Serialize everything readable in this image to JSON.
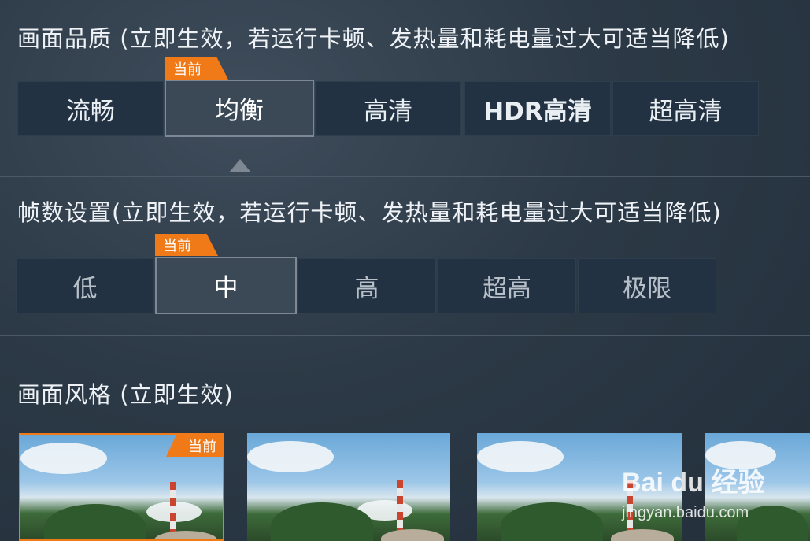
{
  "quality": {
    "title": "画面品质 (立即生效，若运行卡顿、发热量和耗电量过大可适当降低)",
    "current_badge": "当前",
    "options": [
      "流畅",
      "均衡",
      "高清",
      "HDR高清",
      "超高清"
    ],
    "selected": "均衡"
  },
  "framerate": {
    "title": "帧数设置(立即生效，若运行卡顿、发热量和耗电量过大可适当降低)",
    "current_badge": "当前",
    "options": [
      "低",
      "中",
      "高",
      "超高",
      "极限"
    ],
    "selected": "中"
  },
  "style": {
    "title": "画面风格 (立即生效)",
    "current_badge": "当前"
  },
  "watermark": {
    "brand": "Bai du 经验",
    "url": "jingyan.baidu.com"
  },
  "colors": {
    "accent": "#f07a18",
    "button_bg": "#233242",
    "selected_bg": "#3b4855"
  }
}
